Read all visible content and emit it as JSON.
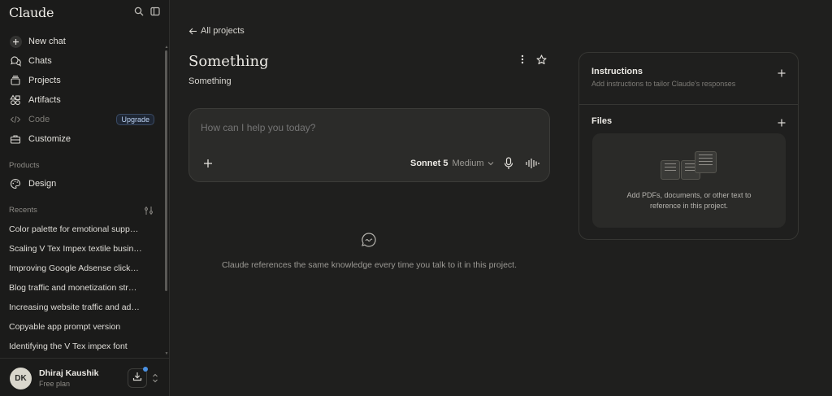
{
  "app": {
    "brand": "Claude"
  },
  "sidebar": {
    "nav": [
      {
        "label": "New chat",
        "icon": "plus-icon"
      },
      {
        "label": "Chats",
        "icon": "chat-icon"
      },
      {
        "label": "Projects",
        "icon": "projects-icon"
      },
      {
        "label": "Artifacts",
        "icon": "artifacts-icon"
      },
      {
        "label": "Code",
        "icon": "code-icon",
        "badge": "Upgrade"
      },
      {
        "label": "Customize",
        "icon": "toolbox-icon"
      }
    ],
    "products_label": "Products",
    "products": [
      {
        "label": "Design",
        "icon": "palette-icon"
      }
    ],
    "recents_label": "Recents",
    "recents": [
      "Color palette for emotional supp…",
      "Scaling V Tex Impex textile busin…",
      "Improving Google Adsense click…",
      "Blog traffic and monetization str…",
      "Increasing website traffic and ad…",
      "Copyable app prompt version",
      "Identifying the V Tex impex font"
    ],
    "user": {
      "initials": "DK",
      "name": "Dhiraj Kaushik",
      "plan": "Free plan"
    }
  },
  "main": {
    "back_label": "All projects",
    "title": "Something",
    "subtitle": "Something",
    "composer": {
      "placeholder": "How can I help you today?",
      "model": "Sonnet 5",
      "effort": "Medium"
    },
    "empty_text": "Claude references the same knowledge every time you talk to it in this project."
  },
  "panel": {
    "instructions": {
      "title": "Instructions",
      "desc": "Add instructions to tailor Claude's responses"
    },
    "files": {
      "title": "Files",
      "line1": "Add PDFs, documents, or other text to",
      "line2": "reference in this project."
    }
  },
  "colors": {
    "background": "#1f1f1e",
    "sidebar": "#1b1b1a",
    "composer": "#2b2b29",
    "accent_blue": "#4a90e2"
  }
}
